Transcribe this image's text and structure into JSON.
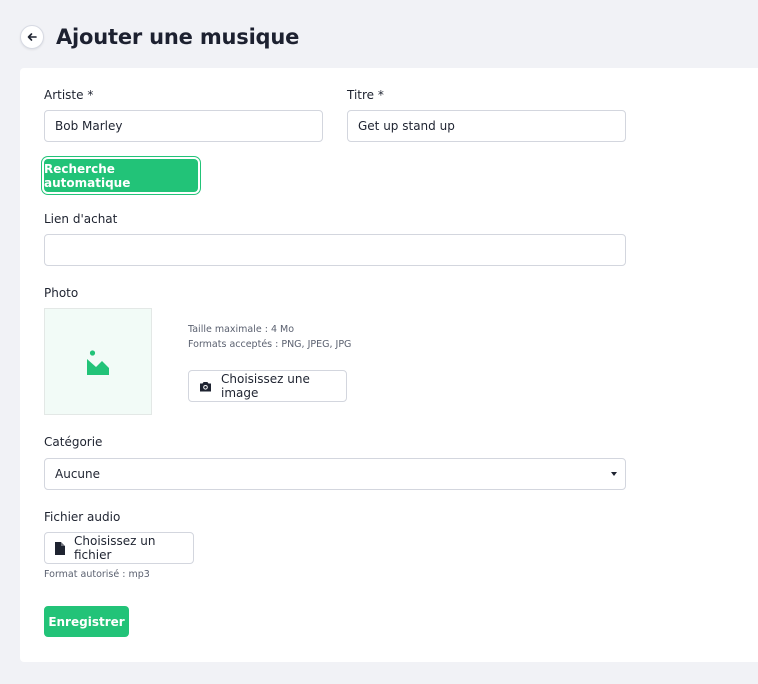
{
  "header": {
    "title": "Ajouter une musique"
  },
  "form": {
    "artist": {
      "label": "Artiste *",
      "value": "Bob Marley"
    },
    "title": {
      "label": "Titre *",
      "value": "Get up stand up"
    },
    "auto_search_label": "Recherche automatique",
    "purchase_link": {
      "label": "Lien d'achat",
      "value": ""
    },
    "photo": {
      "label": "Photo",
      "max_size": "Taille maximale : 4 Mo",
      "formats": "Formats acceptés : PNG, JPEG, JPG",
      "choose_label": "Choisissez une image"
    },
    "category": {
      "label": "Catégorie",
      "selected": "Aucune"
    },
    "audio": {
      "label": "Fichier audio",
      "choose_label": "Choisissez un fichier",
      "format_hint": "Format autorisé : mp3"
    },
    "save_label": "Enregistrer"
  },
  "colors": {
    "accent": "#22c378",
    "background": "#f1f2f6"
  },
  "icons": {
    "back": "arrow-left-icon",
    "image_placeholder": "image-icon",
    "camera": "camera-icon",
    "file": "file-icon",
    "caret": "caret-down-icon"
  }
}
